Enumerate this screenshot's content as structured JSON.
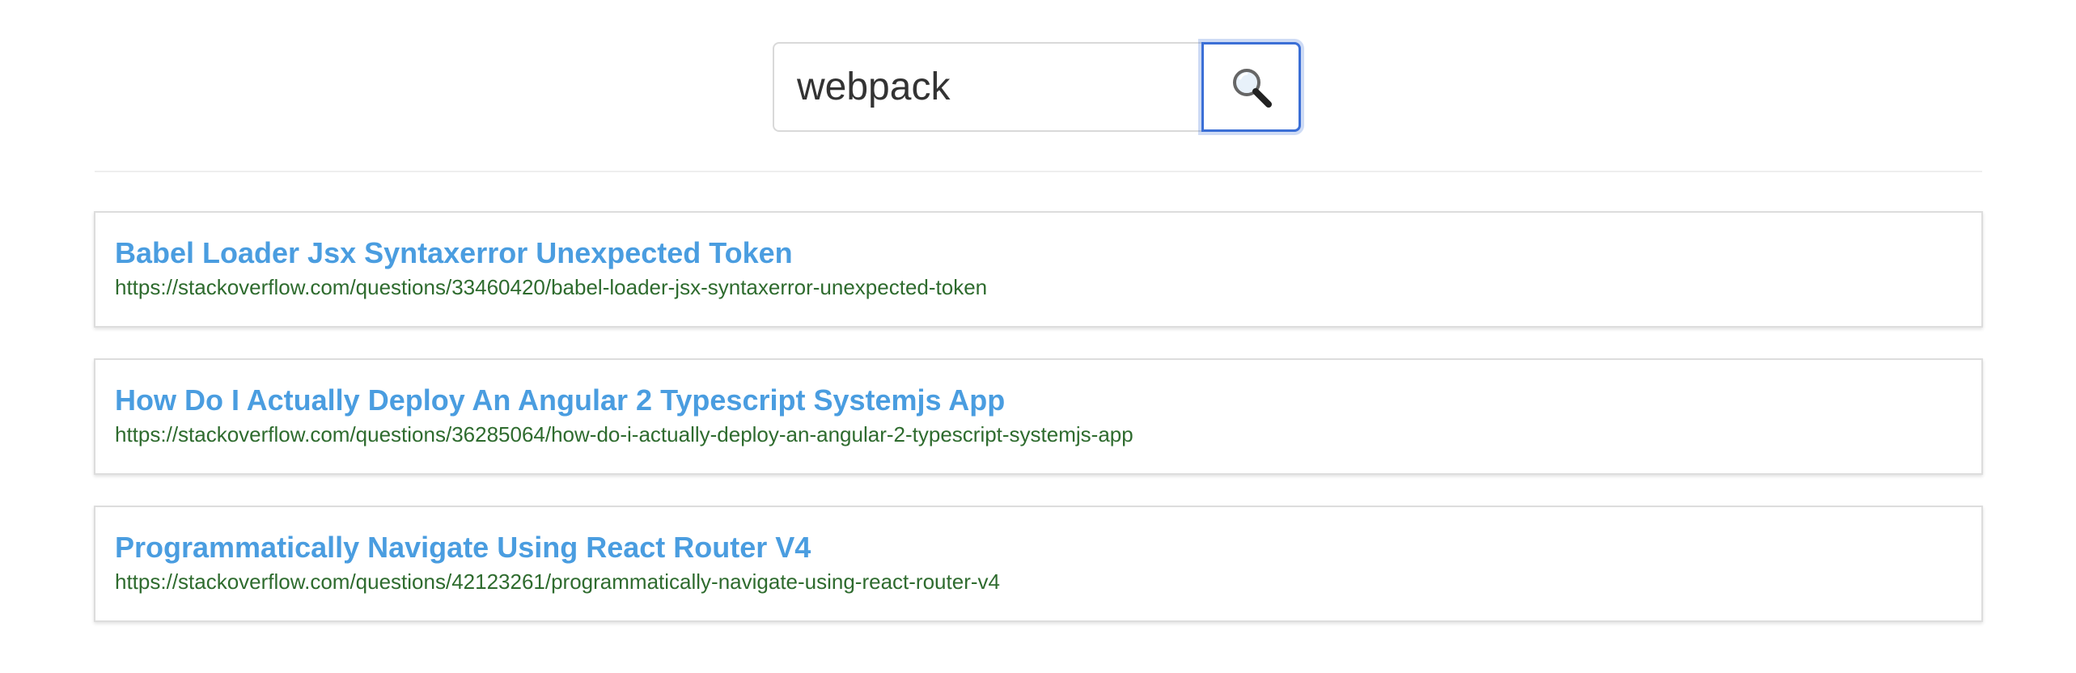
{
  "search": {
    "value": "webpack",
    "button_icon": "magnifying-glass-icon"
  },
  "results": [
    {
      "title": "Babel Loader Jsx Syntaxerror Unexpected Token",
      "url": "https://stackoverflow.com/questions/33460420/babel-loader-jsx-syntaxerror-unexpected-token"
    },
    {
      "title": "How Do I Actually Deploy An Angular 2 Typescript Systemjs App",
      "url": "https://stackoverflow.com/questions/36285064/how-do-i-actually-deploy-an-angular-2-typescript-systemjs-app"
    },
    {
      "title": "Programmatically Navigate Using React Router V4",
      "url": "https://stackoverflow.com/questions/42123261/programmatically-navigate-using-react-router-v4"
    }
  ],
  "colors": {
    "title": "#4a9de0",
    "url": "#2e6b2e",
    "focus_border": "#3b6fd6"
  }
}
